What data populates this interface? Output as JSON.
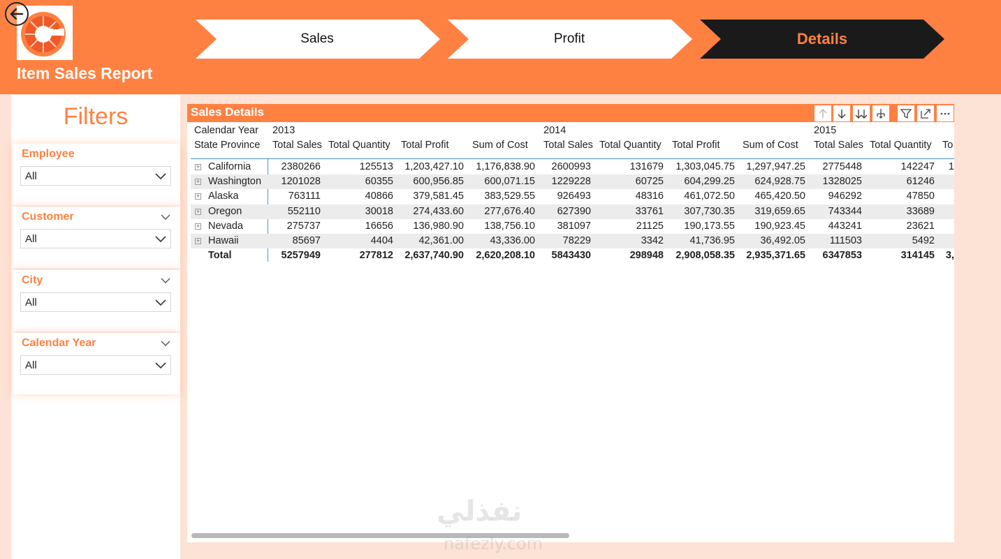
{
  "app": {
    "title": "Item Sales Report"
  },
  "nav": [
    {
      "label": "Sales",
      "active": false
    },
    {
      "label": "Profit",
      "active": false
    },
    {
      "label": "Details",
      "active": true
    }
  ],
  "filters": {
    "title": "Filters",
    "items": [
      {
        "label": "Employee",
        "value": "All",
        "has_header_chevron": false
      },
      {
        "label": "Customer",
        "value": "All",
        "has_header_chevron": true
      },
      {
        "label": "City",
        "value": "All",
        "has_header_chevron": true
      },
      {
        "label": "Calendar Year",
        "value": "All",
        "has_header_chevron": true
      }
    ]
  },
  "table": {
    "title": "Sales Details",
    "row_header_top": "Calendar Year",
    "row_header_bottom": "State Province",
    "years": [
      "2013",
      "2014",
      "2015"
    ],
    "columns": [
      "Total Sales",
      "Total Quantity",
      "Total Profit",
      "Sum of Cost",
      "Total Sales",
      "Total Quantity",
      "Total Profit",
      "Sum of Cost",
      "Total Sales",
      "Total Quantity",
      "To"
    ],
    "rows": [
      {
        "name": "California",
        "values": [
          "2380266",
          "125513",
          "1,203,427.10",
          "1,176,838.90",
          "2600993",
          "131679",
          "1,303,045.75",
          "1,297,947.25",
          "2775448",
          "142247",
          "1"
        ]
      },
      {
        "name": "Washington",
        "values": [
          "1201028",
          "60355",
          "600,956.85",
          "600,071.15",
          "1229228",
          "60725",
          "604,299.25",
          "624,928.75",
          "1328025",
          "61246",
          ""
        ]
      },
      {
        "name": "Alaska",
        "values": [
          "763111",
          "40866",
          "379,581.45",
          "383,529.55",
          "926493",
          "48316",
          "461,072.50",
          "465,420.50",
          "946292",
          "47850",
          ""
        ]
      },
      {
        "name": "Oregon",
        "values": [
          "552110",
          "30018",
          "274,433.60",
          "277,676.40",
          "627390",
          "33761",
          "307,730.35",
          "319,659.65",
          "743344",
          "33689",
          ""
        ]
      },
      {
        "name": "Nevada",
        "values": [
          "275737",
          "16656",
          "136,980.90",
          "138,756.10",
          "381097",
          "21125",
          "190,173.55",
          "190,923.45",
          "443241",
          "23621",
          ""
        ]
      },
      {
        "name": "Hawaii",
        "values": [
          "85697",
          "4404",
          "42,361.00",
          "43,336.00",
          "78229",
          "3342",
          "41,736.95",
          "36,492.05",
          "111503",
          "5492",
          ""
        ]
      }
    ],
    "total": {
      "name": "Total",
      "values": [
        "5257949",
        "277812",
        "2,637,740.90",
        "2,620,208.10",
        "5843430",
        "298948",
        "2,908,058.35",
        "2,935,371.65",
        "6347853",
        "314145",
        "3,"
      ]
    }
  },
  "toolbar_icons": [
    "drill-up-icon",
    "drill-down-icon",
    "expand-next-level-icon",
    "expand-hierarchy-icon",
    "filter-icon",
    "focus-mode-icon",
    "more-options-icon"
  ],
  "watermark": {
    "text": "نفذلي",
    "sub": "nafezly.com"
  },
  "colors": {
    "accent": "#ff8142",
    "page_bg": "#fde3d5",
    "active_nav": "#1a1a1a",
    "active_nav_text": "#ff8142"
  }
}
